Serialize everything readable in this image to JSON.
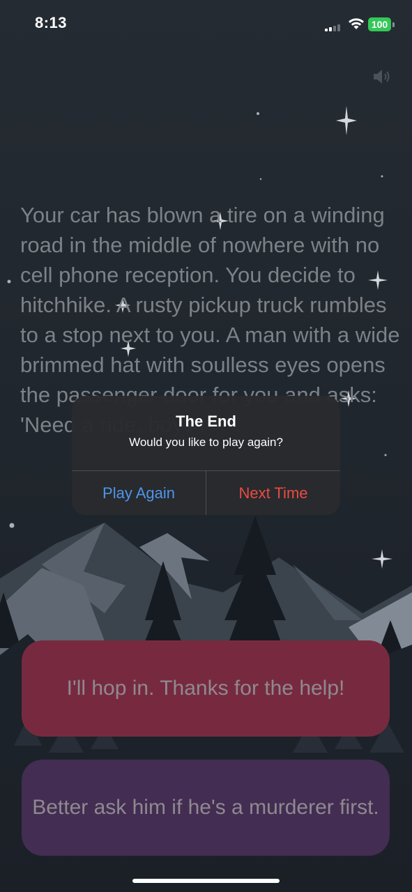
{
  "status_bar": {
    "time": "8:13",
    "battery_level": "100",
    "icons": [
      "signal-icon",
      "wifi-icon",
      "battery-icon"
    ]
  },
  "header": {
    "sound_icon": "speaker-icon"
  },
  "story": {
    "text": "Your car has blown a tire on a winding road in the middle of nowhere with no cell phone reception. You decide to hitchhike. A rusty pickup truck rumbles to a stop next to you. A man with a wide brimmed hat with soulless eyes opens the passenger door for you and asks: 'Need a ride, boy?'."
  },
  "choices": [
    {
      "label": "I'll hop in. Thanks for the help!",
      "color": "#772a3f"
    },
    {
      "label": "Better ask him if he's a murderer first.",
      "color": "#432d52"
    }
  ],
  "alert": {
    "title": "The End",
    "message": "Would you like to play again?",
    "buttons": {
      "play_again": "Play Again",
      "next_time": "Next Time"
    },
    "colors": {
      "play_again": "#4f95e8",
      "next_time": "#ea4b43"
    }
  }
}
